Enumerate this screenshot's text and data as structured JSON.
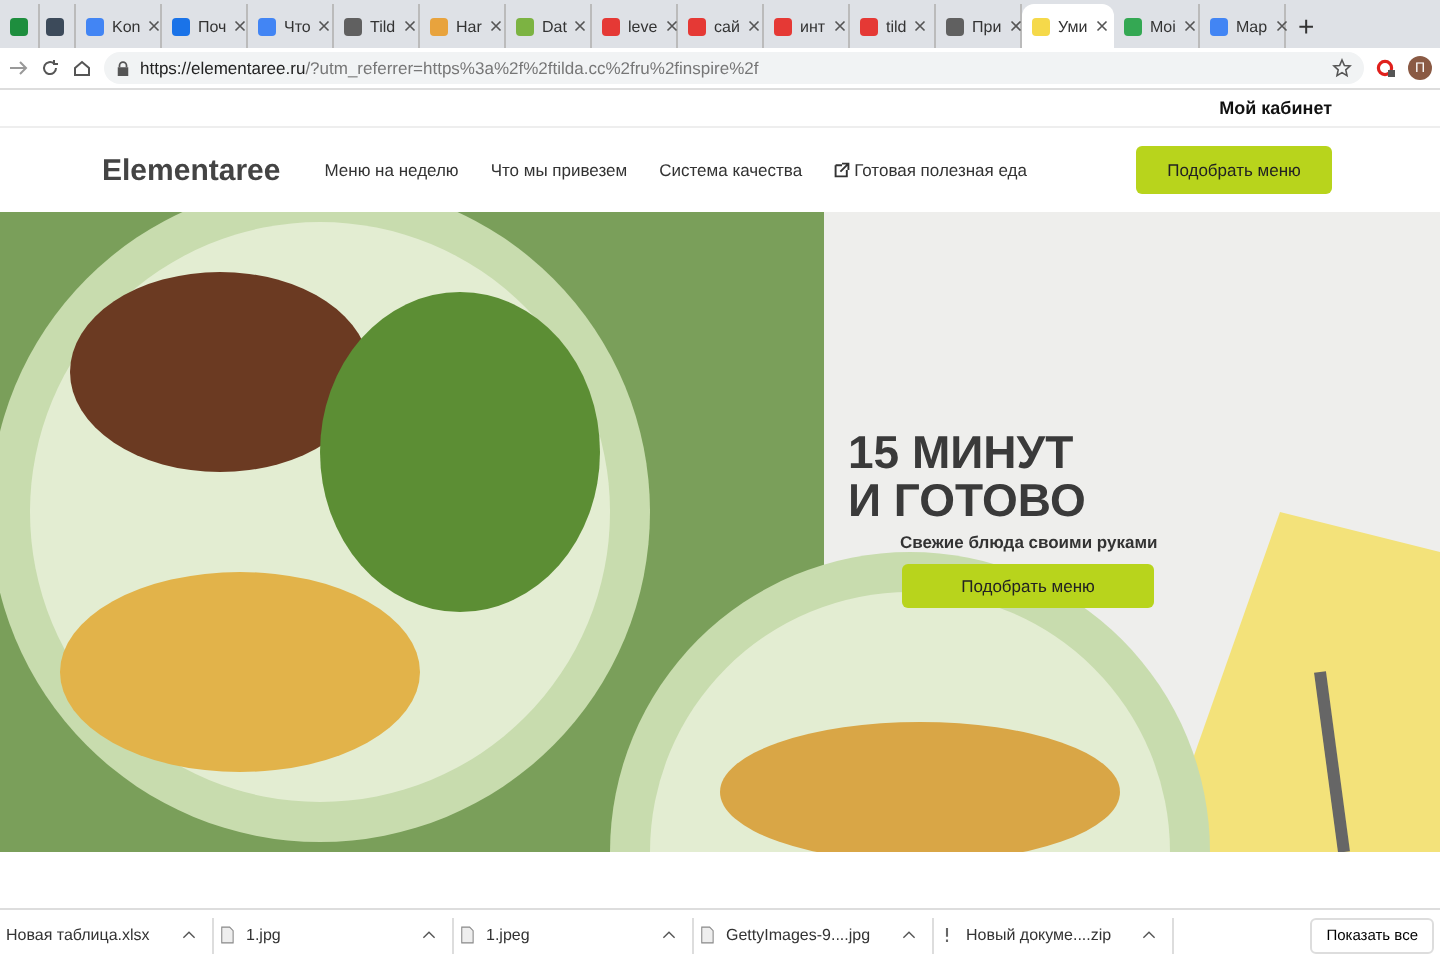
{
  "browser": {
    "tabs": [
      {
        "color": "#1e8e3e",
        "selected": false
      },
      {
        "color": "#3c4a5a",
        "selected": false
      },
      {
        "title": "Kon",
        "color": "#4285f4",
        "selected": false
      },
      {
        "title": "Поч",
        "color": "#1a73e8",
        "selected": false
      },
      {
        "title": "Что",
        "color": "#4285f4",
        "selected": false
      },
      {
        "title": "Tild",
        "color": "#606060",
        "selected": false
      },
      {
        "title": "Har",
        "color": "#e8a33d",
        "selected": false
      },
      {
        "title": "Dat",
        "color": "#7cb342",
        "selected": false
      },
      {
        "title": "leve",
        "color": "#e53935",
        "selected": false
      },
      {
        "title": "сай",
        "color": "#e53935",
        "selected": false
      },
      {
        "title": "инт",
        "color": "#e53935",
        "selected": false
      },
      {
        "title": "tild",
        "color": "#e53935",
        "selected": false
      },
      {
        "title": "При",
        "color": "#606060",
        "selected": false
      },
      {
        "title": "Уми",
        "color": "#f5d94a",
        "selected": true
      },
      {
        "title": "Moi",
        "color": "#34a853",
        "selected": false
      },
      {
        "title": "Map",
        "color": "#4285f4",
        "selected": false
      }
    ],
    "new_tab": "+",
    "url_host": "https://elementaree.ru",
    "url_rest": "/?utm_referrer=https%3a%2f%2ftilda.cc%2fru%2finspire%2f",
    "profile_initial": "П"
  },
  "site": {
    "account_link": "Мой кабинет",
    "logo": "Elementaree",
    "nav": [
      {
        "label": "Меню на неделю",
        "external": false
      },
      {
        "label": "Что мы привезем",
        "external": false
      },
      {
        "label": "Система качества",
        "external": false
      },
      {
        "label": "Готовая полезная еда",
        "external": true
      }
    ],
    "nav_button": "Подобрать меню",
    "hero": {
      "title_line_1": "15 МИНУТ",
      "title_line_2": "И ГОТОВО",
      "subtitle": "Свежие блюда своими руками",
      "button": "Подобрать меню"
    }
  },
  "downloads": {
    "items": [
      {
        "name": "Новая таблица.xlsx",
        "kind": "plain"
      },
      {
        "name": "1.jpg",
        "kind": "file"
      },
      {
        "name": "1.jpeg",
        "kind": "file"
      },
      {
        "name": "GettyImages-9....jpg",
        "kind": "file"
      },
      {
        "name": "Новый докуме....zip",
        "kind": "warning"
      }
    ],
    "show_all": "Показать все"
  }
}
